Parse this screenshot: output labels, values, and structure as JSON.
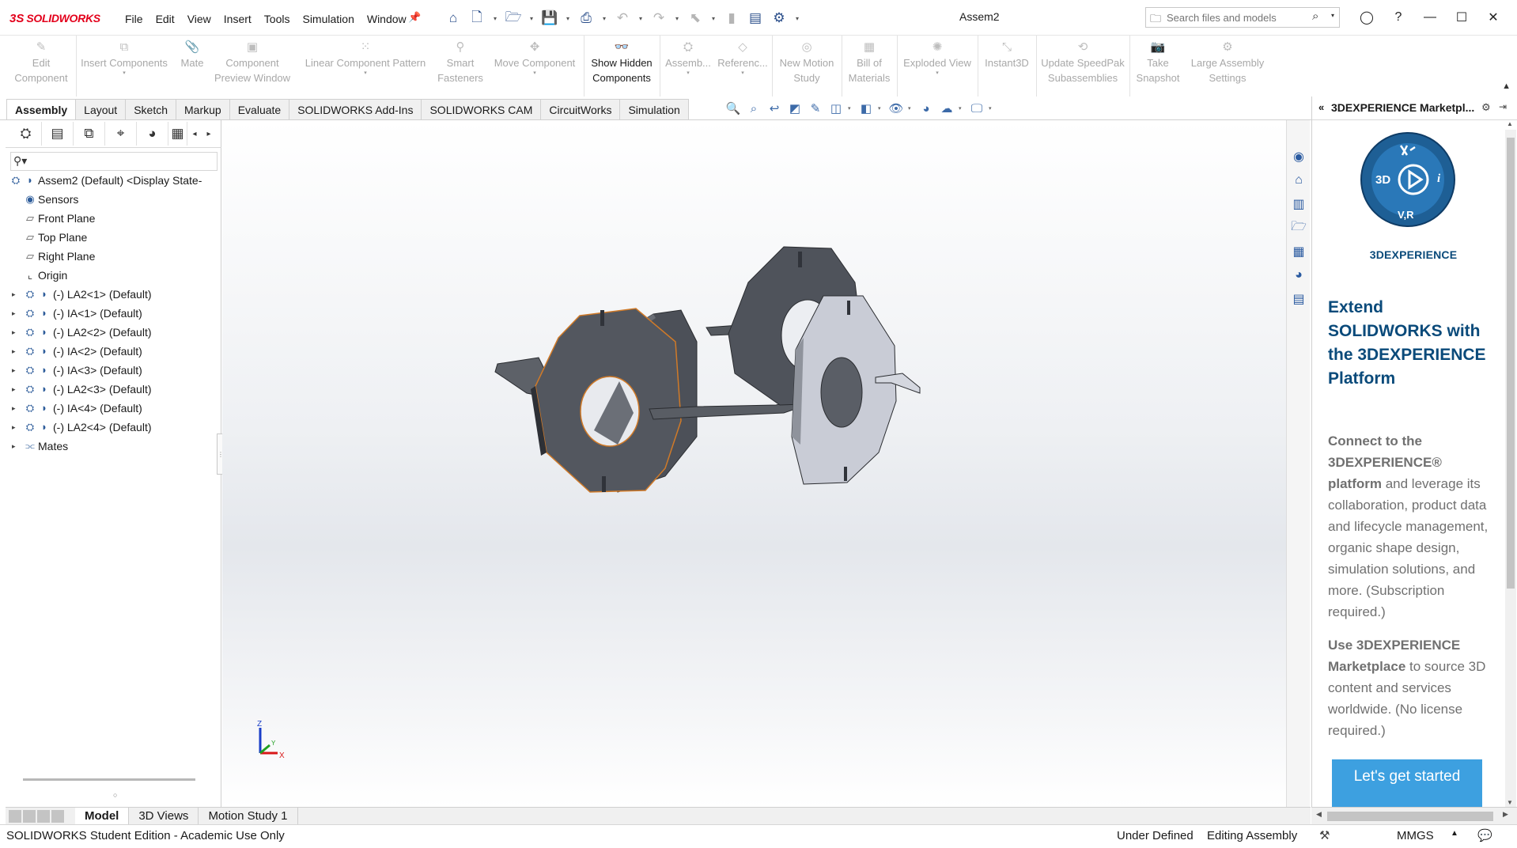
{
  "app": {
    "brand": "SOLIDWORKS",
    "brand_mark": "3S",
    "document_title": "Assem2"
  },
  "menu": [
    "File",
    "Edit",
    "View",
    "Insert",
    "Tools",
    "Simulation",
    "Window"
  ],
  "quick_access": [
    "home-icon",
    "new-document-icon",
    "open-icon",
    "save-icon",
    "print-icon",
    "undo-icon",
    "redo-icon",
    "select-icon",
    "rebuild-icon",
    "file-properties-icon",
    "options-icon"
  ],
  "search": {
    "placeholder": "Search files and models"
  },
  "commands": [
    {
      "label": "Edit\nComponent",
      "icon": "edit-component-icon",
      "enabled": false
    },
    {
      "label": "Insert Components",
      "icon": "insert-components-icon",
      "enabled": false
    },
    {
      "label": "Mate",
      "icon": "mate-icon",
      "enabled": false
    },
    {
      "label": "Component\nPreview Window",
      "icon": "preview-window-icon",
      "enabled": false
    },
    {
      "label": "Linear Component Pattern",
      "icon": "linear-pattern-icon",
      "enabled": false
    },
    {
      "label": "Smart\nFasteners",
      "icon": "smart-fasteners-icon",
      "enabled": false
    },
    {
      "label": "Move Component",
      "icon": "move-component-icon",
      "enabled": false
    },
    {
      "label": "Show Hidden\nComponents",
      "icon": "show-hidden-icon",
      "enabled": true
    },
    {
      "label": "Assemb...",
      "icon": "assembly-features-icon",
      "enabled": false
    },
    {
      "label": "Referenc...",
      "icon": "reference-geometry-icon",
      "enabled": false
    },
    {
      "label": "New Motion\nStudy",
      "icon": "motion-study-icon",
      "enabled": false
    },
    {
      "label": "Bill of\nMaterials",
      "icon": "bom-icon",
      "enabled": false
    },
    {
      "label": "Exploded View",
      "icon": "exploded-view-icon",
      "enabled": false
    },
    {
      "label": "Instant3D",
      "icon": "instant3d-icon",
      "enabled": false
    },
    {
      "label": "Update SpeedPak\nSubassemblies",
      "icon": "speedpak-icon",
      "enabled": false
    },
    {
      "label": "Take\nSnapshot",
      "icon": "snapshot-icon",
      "enabled": false
    },
    {
      "label": "Large Assembly\nSettings",
      "icon": "large-assembly-icon",
      "enabled": false
    }
  ],
  "tabs": [
    {
      "label": "Assembly",
      "active": true
    },
    {
      "label": "Layout",
      "active": false
    },
    {
      "label": "Sketch",
      "active": false
    },
    {
      "label": "Markup",
      "active": false
    },
    {
      "label": "Evaluate",
      "active": false
    },
    {
      "label": "SOLIDWORKS Add-Ins",
      "active": false
    },
    {
      "label": "SOLIDWORKS CAM",
      "active": false
    },
    {
      "label": "CircuitWorks",
      "active": false
    },
    {
      "label": "Simulation",
      "active": false
    }
  ],
  "feature_tree": [
    {
      "label": "Assem2 (Default) <Display State-",
      "icon": "assembly-icon",
      "level": 0,
      "expander": false
    },
    {
      "label": "Sensors",
      "icon": "sensors-icon",
      "level": 1,
      "expander": false
    },
    {
      "label": "Front Plane",
      "icon": "plane-icon",
      "level": 1,
      "expander": false
    },
    {
      "label": "Top Plane",
      "icon": "plane-icon",
      "level": 1,
      "expander": false
    },
    {
      "label": "Right Plane",
      "icon": "plane-icon",
      "level": 1,
      "expander": false
    },
    {
      "label": "Origin",
      "icon": "origin-icon",
      "level": 1,
      "expander": false
    },
    {
      "label": "(-) LA2<1> (Default)",
      "icon": "part-icon",
      "level": 1,
      "expander": true
    },
    {
      "label": "(-) IA<1> (Default)",
      "icon": "part-icon",
      "level": 1,
      "expander": true
    },
    {
      "label": "(-) LA2<2> (Default)",
      "icon": "part-icon",
      "level": 1,
      "expander": true
    },
    {
      "label": "(-) IA<2> (Default)",
      "icon": "part-icon",
      "level": 1,
      "expander": true
    },
    {
      "label": "(-) IA<3> (Default)",
      "icon": "part-icon",
      "level": 1,
      "expander": true
    },
    {
      "label": "(-) LA2<3> (Default)",
      "icon": "part-icon",
      "level": 1,
      "expander": true
    },
    {
      "label": "(-) IA<4> (Default)",
      "icon": "part-icon",
      "level": 1,
      "expander": true
    },
    {
      "label": "(-) LA2<4> (Default)",
      "icon": "part-icon",
      "level": 1,
      "expander": true
    },
    {
      "label": "Mates",
      "icon": "mates-icon",
      "level": 1,
      "expander": true
    }
  ],
  "triad": {
    "z": "Z",
    "x": "X",
    "y": "Y"
  },
  "task_pane": {
    "title": "3DEXPERIENCE Marketpl...",
    "brand_line": "3DEXPERIENCE",
    "badge_center": "3D",
    "badge_bottom": "V,R",
    "badge_right": "i",
    "headline": "Extend SOLIDWORKS with the 3DEXPERIENCE Platform",
    "p1_bold": "Connect to the 3DEXPERIENCE® platform",
    "p1_rest": " and leverage its collaboration, product data and lifecycle management, organic shape design, simulation solutions, and more. (Subscription required.)",
    "p2_bold": "Use 3DEXPERIENCE Marketplace",
    "p2_rest": " to source 3D content and services worldwide. (No license required.)",
    "cta": "Let's get started"
  },
  "task_icons": [
    "3dexperience-icon",
    "resources-home-icon",
    "design-library-icon",
    "file-explorer-icon",
    "view-palette-icon",
    "appearances-icon",
    "custom-properties-icon"
  ],
  "bottom_tabs": [
    {
      "label": "Model",
      "active": true
    },
    {
      "label": "3D Views",
      "active": false
    },
    {
      "label": "Motion Study 1",
      "active": false
    }
  ],
  "status": {
    "edition": "SOLIDWORKS Student Edition - Academic Use Only",
    "state": "Under Defined",
    "mode": "Editing Assembly",
    "units": "MMGS"
  }
}
